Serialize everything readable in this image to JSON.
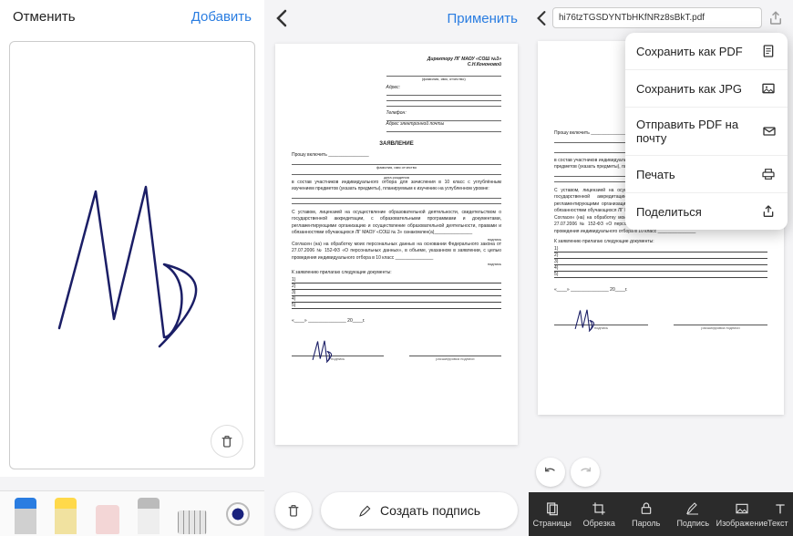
{
  "panel1": {
    "cancel": "Отменить",
    "add": "Добавить",
    "tools": {
      "pen": "pen",
      "highlighter": "highlighter",
      "eraser": "eraser",
      "pencil": "pencil",
      "ruler": "ruler",
      "color": "#1a237e"
    }
  },
  "panel2": {
    "apply": "Применить",
    "create_signature": "Создать подпись",
    "doc": {
      "header_line1": "Директору   ЛГ   МАОУ   «СОШ   №3»",
      "header_line2": "С.Н.Кононовой",
      "addr_label": "Адрес:",
      "tel_label": "Телефон:",
      "email_label": "Адрес электронной почты",
      "title": "ЗАЯВЛЕНИЕ",
      "p1": "Прошу включить ________________",
      "p1b": "фамилия, имя отчество",
      "p1c": "дата рождения",
      "p2": "в состав участников индивидуального отбора для зачисления в 10 класс с углублённым изучением предметов (указать предметы), планируемым к изучению на углубленном уровне:",
      "p3": "С уставом, лицензией на осуществление образовательной деятельности, свидетельством о государственной аккредитации, с образовательными программами и документами, регламентирующими организацию и осуществление образовательной деятельности, правами и обязанностями обучающихся ЛГ МАОУ «СОШ № 3» ознакомлен(а)_______________",
      "p3b": "подпись",
      "p4": "Согласен (на) на обработку моих персональных данных на основании Федерального закона от 27.07.2006 № 152-ФЗ «О персональных данных», в объеме, указанном в заявлении, с целью проведения индивидуального отбора в 10 класс _______________",
      "p4b": "подпись",
      "attach": "К заявлению прилагаю следующие документы:",
      "list": [
        "1)",
        "2)",
        "3)",
        "4)",
        "5)"
      ],
      "date": "«____» _______________ 20____г.",
      "sig_caption_left": "подпись",
      "sig_caption_right": "расшифровка подписи"
    }
  },
  "panel3": {
    "filename": "hi76tzTGSDYNTbHKfNRz8sBkT.pdf",
    "menu": {
      "save_pdf": "Сохранить как PDF",
      "save_jpg": "Сохранить как JPG",
      "send_pdf": "Отправить PDF на почту",
      "print": "Печать",
      "share": "Поделиться"
    },
    "tabs": {
      "pages": "Страницы",
      "crop": "Обрезка",
      "password": "Пароль",
      "sign": "Подпись",
      "image": "Изображение",
      "text": "Текст"
    }
  }
}
